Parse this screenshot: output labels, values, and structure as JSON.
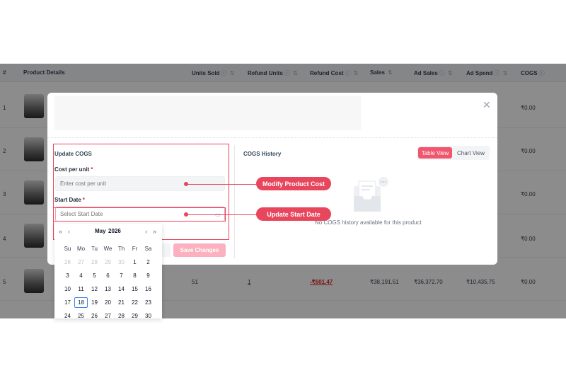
{
  "table": {
    "headers": [
      {
        "label": "#",
        "info": false,
        "sort": false
      },
      {
        "label": "Product Details",
        "info": false,
        "sort": false
      },
      {
        "label": "Units Sold",
        "info": true,
        "sort": true
      },
      {
        "label": "Refund Units",
        "info": true,
        "sort": true
      },
      {
        "label": "Refund Cost",
        "info": true,
        "sort": true
      },
      {
        "label": "Sales",
        "info": false,
        "sort": true
      },
      {
        "label": "Ad Sales",
        "info": true,
        "sort": true
      },
      {
        "label": "Ad Spend",
        "info": true,
        "sort": true
      },
      {
        "label": "COGS",
        "info": true,
        "sort": false
      }
    ],
    "rows": [
      {
        "num": "1",
        "units_sold": "",
        "refund_units": "",
        "refund_cost": "",
        "sales": "",
        "ad_sales": "",
        "ad_spend": "",
        "cogs": "₹0.00"
      },
      {
        "num": "2",
        "units_sold": "",
        "refund_units": "",
        "refund_cost": "",
        "sales": "",
        "ad_sales": "",
        "ad_spend": "",
        "cogs": "₹0.00"
      },
      {
        "num": "3",
        "units_sold": "",
        "refund_units": "",
        "refund_cost": "",
        "sales": "",
        "ad_sales": "",
        "ad_spend": "",
        "cogs": "₹0.00"
      },
      {
        "num": "4",
        "units_sold": "",
        "refund_units": "",
        "refund_cost": "",
        "sales": "",
        "ad_sales": "",
        "ad_spend": "",
        "cogs": "₹0.00"
      },
      {
        "num": "5",
        "units_sold": "51",
        "refund_units": "1",
        "refund_cost": "-₹601.47",
        "sales": "₹38,191.51",
        "ad_sales": "₹36,372.70",
        "ad_spend": "₹10,435.75",
        "cogs": "₹0.00"
      }
    ]
  },
  "modal": {
    "close_icon": "close-icon",
    "update": {
      "title": "Update COGS",
      "cost_label": "Cost per unit",
      "cost_placeholder": "Enter cost per unit",
      "date_label": "Start Date",
      "date_placeholder": "Select Start Date",
      "required_mark": "*",
      "save_label": "Save Changes"
    },
    "history": {
      "title": "COGS History",
      "table_view": "Table View",
      "chart_view": "Chart View",
      "active_view": "Table View",
      "empty_text": "No COGS history available for this product"
    }
  },
  "callouts": {
    "cost": "Modify Product Cost",
    "date": "Update Start Date"
  },
  "calendar": {
    "month": "May",
    "year": "2026",
    "weekdays": [
      "Su",
      "Mo",
      "Tu",
      "We",
      "Th",
      "Fr",
      "Sa"
    ],
    "weeks": [
      [
        "26",
        "27",
        "28",
        "29",
        "30",
        "1",
        "2"
      ],
      [
        "3",
        "4",
        "5",
        "6",
        "7",
        "8",
        "9"
      ],
      [
        "10",
        "11",
        "12",
        "13",
        "14",
        "15",
        "16"
      ],
      [
        "17",
        "18",
        "19",
        "20",
        "21",
        "22",
        "23"
      ],
      [
        "24",
        "25",
        "26",
        "27",
        "28",
        "29",
        "30"
      ]
    ],
    "selected": "18",
    "nav": {
      "prev_year": "«",
      "prev_month": "‹",
      "next_month": "›",
      "next_year": "»"
    }
  },
  "colors": {
    "accent": "#e8465c",
    "toggle_active": "#f0566e",
    "save_disabled": "#fbb1bf",
    "refund_cost": "#dc2626"
  }
}
